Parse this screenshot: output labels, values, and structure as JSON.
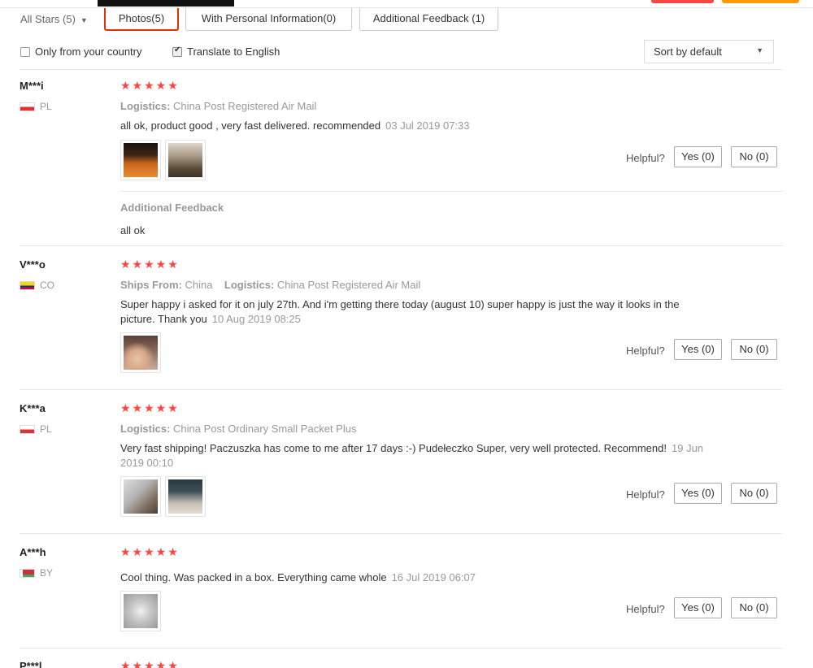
{
  "filters": {
    "all_stars": "All Stars (5)",
    "tabs": [
      {
        "label": "Photos(5)"
      },
      {
        "label": "With Personal Information(0)"
      },
      {
        "label": "Additional Feedback (1)"
      }
    ],
    "only_country": "Only from your country",
    "translate": "Translate to English",
    "translate_checked": true,
    "sort": "Sort by default"
  },
  "helpful_label": "Helpful?",
  "reviews": [
    {
      "user": "M***i",
      "country": "PL",
      "stars": "★★★★★",
      "logistics_label": "Logistics:",
      "logistics_value": "China Post Registered Air Mail",
      "text": "all ok, product good , very fast delivered. recommended",
      "date": "03 Jul 2019 07:33",
      "yes": "Yes (0)",
      "no": "No (0)",
      "additional_title": "Additional Feedback",
      "additional_text": "all ok"
    },
    {
      "user": "V***o",
      "country": "CO",
      "stars": "★★★★★",
      "ships_label": "Ships From:",
      "ships_value": "China",
      "logistics_label": "Logistics:",
      "logistics_value": "China Post Registered Air Mail",
      "text": "Super happy i asked for it on july 27th. And i'm getting there today (august 10) super happy is just the way it looks in the picture. Thank you",
      "date": "10 Aug 2019 08:25",
      "yes": "Yes (0)",
      "no": "No (0)"
    },
    {
      "user": "K***a",
      "country": "PL",
      "stars": "★★★★★",
      "logistics_label": "Logistics:",
      "logistics_value": "China Post Ordinary Small Packet Plus",
      "text": "Very fast shipping! Paczuszka has come to me after 17 days :-) Pudełeczko Super, very well protected. Recommend!",
      "date": "19 Jun 2019 00:10",
      "yes": "Yes (0)",
      "no": "No (0)"
    },
    {
      "user": "A***h",
      "country": "BY",
      "stars": "★★★★★",
      "text": "Cool thing. Was packed in a box. Everything came whole",
      "date": "16 Jul 2019 06:07",
      "yes": "Yes (0)",
      "no": "No (0)"
    },
    {
      "user": "P***l",
      "stars": "★★★★★"
    }
  ]
}
